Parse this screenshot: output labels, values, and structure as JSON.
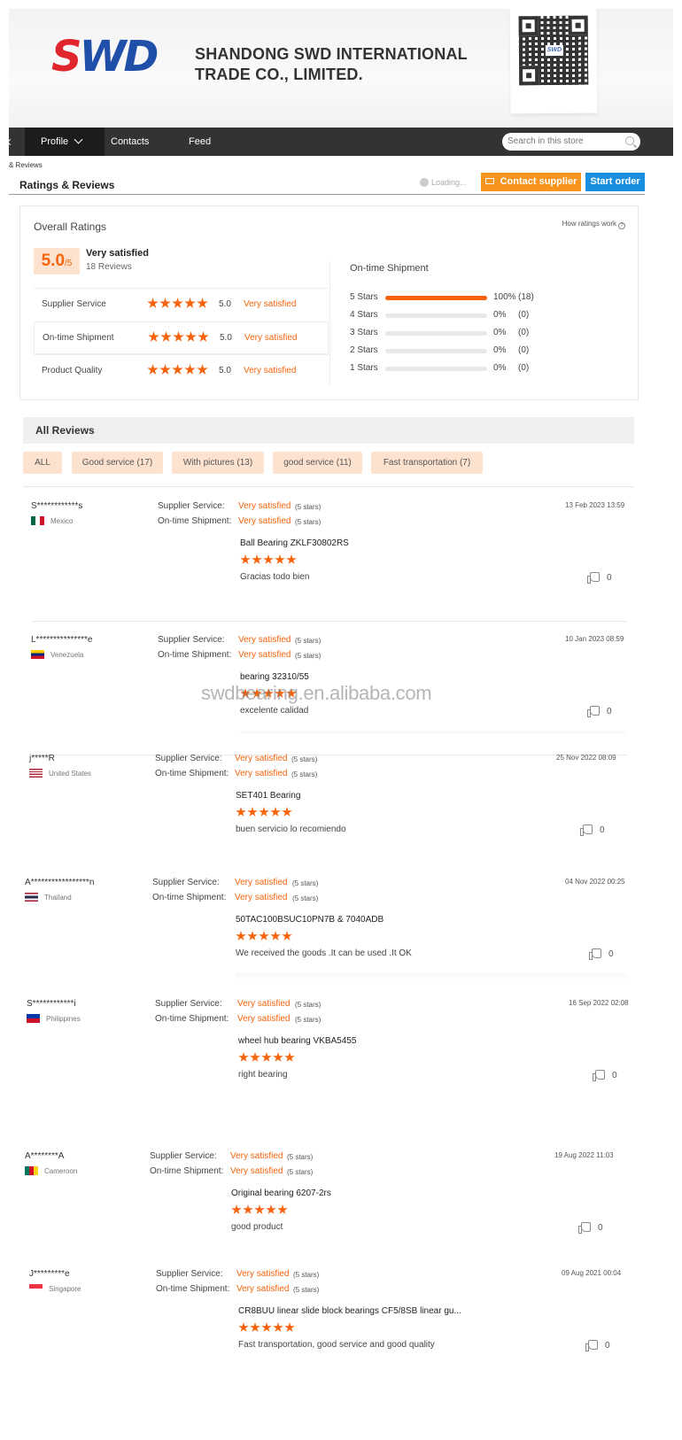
{
  "brand": {
    "logo_s": "S",
    "logo_wd": "WD",
    "company_line1": "SHANDONG SWD INTERNATIONAL",
    "company_line2": "TRADE CO., LIMITED.",
    "qr_label": "SWD"
  },
  "nav": {
    "items": [
      "Profile",
      "Contacts",
      "Feed"
    ],
    "search_placeholder": "Search in this store"
  },
  "breadcrumb": "& Reviews",
  "page": {
    "title": "Ratings & Reviews",
    "loading": "Loading...",
    "contact_button": "Contact supplier",
    "start_button": "Start order"
  },
  "overall": {
    "title": "Overall Ratings",
    "how": "How ratings work",
    "score": "5.0",
    "score_max": "/5",
    "label": "Very satisfied",
    "count": "18 Reviews",
    "criteria": [
      {
        "name": "Supplier Service",
        "score": "5.0",
        "label": "Very satisfied",
        "stars": 5
      },
      {
        "name": "On-time Shipment",
        "score": "5.0",
        "label": "Very satisfied",
        "stars": 5
      },
      {
        "name": "Product Quality",
        "score": "5.0",
        "label": "Very satisfied",
        "stars": 5
      }
    ],
    "shipment_title": "On-time Shipment",
    "shipment_bars": [
      {
        "label": "5 Stars",
        "fraction": 1.0,
        "pct": "100%",
        "count": "(18)"
      },
      {
        "label": "4 Stars",
        "fraction": 0,
        "pct": "0%",
        "count": "(0)"
      },
      {
        "label": "3 Stars",
        "fraction": 0,
        "pct": "0%",
        "count": "(0)"
      },
      {
        "label": "2 Stars",
        "fraction": 0,
        "pct": "0%",
        "count": "(0)"
      },
      {
        "label": "1 Stars",
        "fraction": 0,
        "pct": "0%",
        "count": "(0)"
      }
    ]
  },
  "all_reviews": {
    "title": "All Reviews",
    "filters": [
      "ALL",
      "Good service (17)",
      "With pictures (13)",
      "good service (11)",
      "Fast transportation (7)"
    ]
  },
  "review_labels": {
    "supplier": "Supplier Service:",
    "shipment": "On-time Shipment:",
    "value": "Very satisfied",
    "stars_text": "(5 stars)"
  },
  "reviews": [
    {
      "name": "S************s",
      "country": "Mexico",
      "flag": "mx",
      "date": "13 Feb 2023 13:59",
      "product": "Ball Bearing ZKLF30802RS",
      "text": "Gracias todo bien",
      "likes": "0"
    },
    {
      "name": "L***************e",
      "country": "Venezuela",
      "flag": "ve",
      "date": "10 Jan 2023 08:59",
      "product": "bearing 32310/55",
      "text": "excelente calidad",
      "likes": "0"
    },
    {
      "name": "j*****R",
      "country": "United States",
      "flag": "us",
      "date": "25 Nov 2022 08:09",
      "product": "SET401 Bearing",
      "text": "buen servicio lo recomiendo",
      "likes": "0"
    },
    {
      "name": "A*****************n",
      "country": "Thailand",
      "flag": "th",
      "date": "04 Nov 2022 00:25",
      "product": "50TAC100BSUC10PN7B & 7040ADB",
      "text": "We received the goods .It can be used .It OK",
      "likes": "0"
    },
    {
      "name": "S************i",
      "country": "Philippines",
      "flag": "ph",
      "date": "16 Sep 2022 02:08",
      "product": "wheel hub bearing VKBA5455",
      "text": "right bearing",
      "likes": "0"
    },
    {
      "name": "A********A",
      "country": "Cameroon",
      "flag": "cm",
      "date": "19 Aug 2022 11:03",
      "product": "Original bearing 6207-2rs",
      "text": "good product",
      "likes": "0"
    },
    {
      "name": "J*********e",
      "country": "Singapore",
      "flag": "sg",
      "date": "09 Aug 2021 00:04",
      "product": "CR8BUU linear slide block bearings CF5/8SB linear gu...",
      "text": "Fast transportation, good service and good quality",
      "likes": "0"
    }
  ],
  "watermark": "swdbearing.en.alibaba.com",
  "colors": {
    "accent": "#f7630c",
    "contact": "#f7941d",
    "start": "#1a8fe0",
    "nav": "#333333"
  }
}
